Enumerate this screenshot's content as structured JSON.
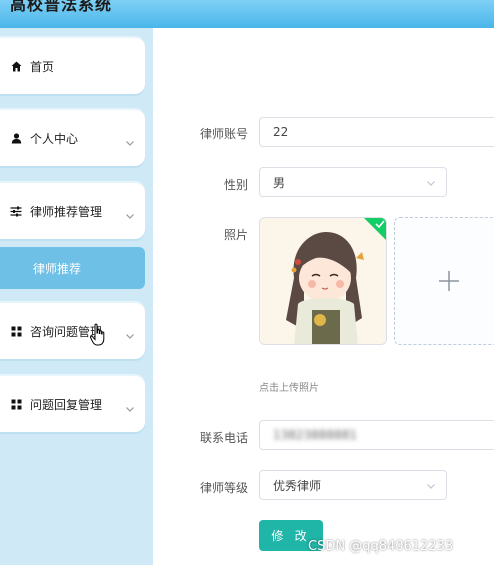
{
  "header": {
    "title": "高校普法系统"
  },
  "sidebar": {
    "items": [
      {
        "label": "首页",
        "icon": "home-icon"
      },
      {
        "label": "个人中心",
        "icon": "user-icon"
      },
      {
        "label": "律师推荐管理",
        "icon": "sliders-icon"
      },
      {
        "label": "咨询问题管理",
        "icon": "grid-icon"
      },
      {
        "label": "问题回复管理",
        "icon": "grid-icon"
      }
    ],
    "active_sub": {
      "label": "律师推荐"
    }
  },
  "form": {
    "account": {
      "label": "律师账号",
      "value": "22"
    },
    "gender": {
      "label": "性别",
      "value": "男"
    },
    "photo": {
      "label": "照片",
      "hint": "点击上传照片"
    },
    "phone": {
      "label": "联系电话",
      "value": "13823888881"
    },
    "level": {
      "label": "律师等级",
      "value": "优秀律师"
    },
    "submit_label": "修 改"
  },
  "watermark": "CSDN @qq840612233",
  "colors": {
    "header": "#49b6ea",
    "sidebar_bg": "#cfe9f6",
    "active_item": "#6ec0e6",
    "submit": "#1fb5a7",
    "success_badge": "#13ce66"
  }
}
